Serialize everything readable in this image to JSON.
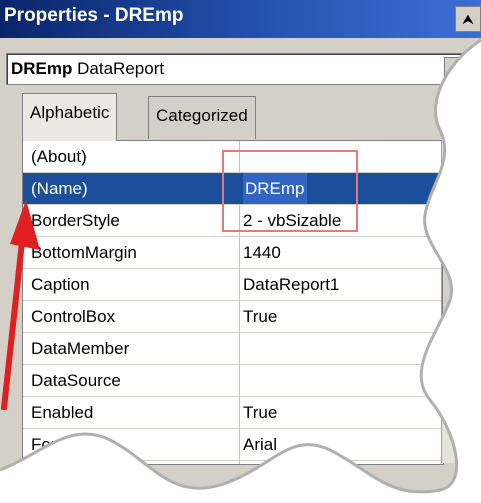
{
  "window": {
    "title": "Properties - DREmp",
    "title_button": "⮝"
  },
  "object_selector": {
    "name_bold": "DREmp",
    "type": "DataReport"
  },
  "tabs": [
    {
      "label": "Alphabetic",
      "active": true
    },
    {
      "label": "Categorized",
      "active": false
    }
  ],
  "properties": [
    {
      "name": "(About)",
      "value": ""
    },
    {
      "name": "(Name)",
      "value": "DREmp"
    },
    {
      "name": "BorderStyle",
      "value": "2 - vbSizable"
    },
    {
      "name": "BottomMargin",
      "value": "1440"
    },
    {
      "name": "Caption",
      "value": "DataReport1"
    },
    {
      "name": "ControlBox",
      "value": "True"
    },
    {
      "name": "DataMember",
      "value": ""
    },
    {
      "name": "DataSource",
      "value": ""
    },
    {
      "name": "Enabled",
      "value": "True"
    },
    {
      "name": "Font",
      "value": "Arial"
    }
  ],
  "colors": {
    "selection": "#1b4f9c",
    "annotation": "#e02020",
    "title_bar": "#0a246a"
  }
}
